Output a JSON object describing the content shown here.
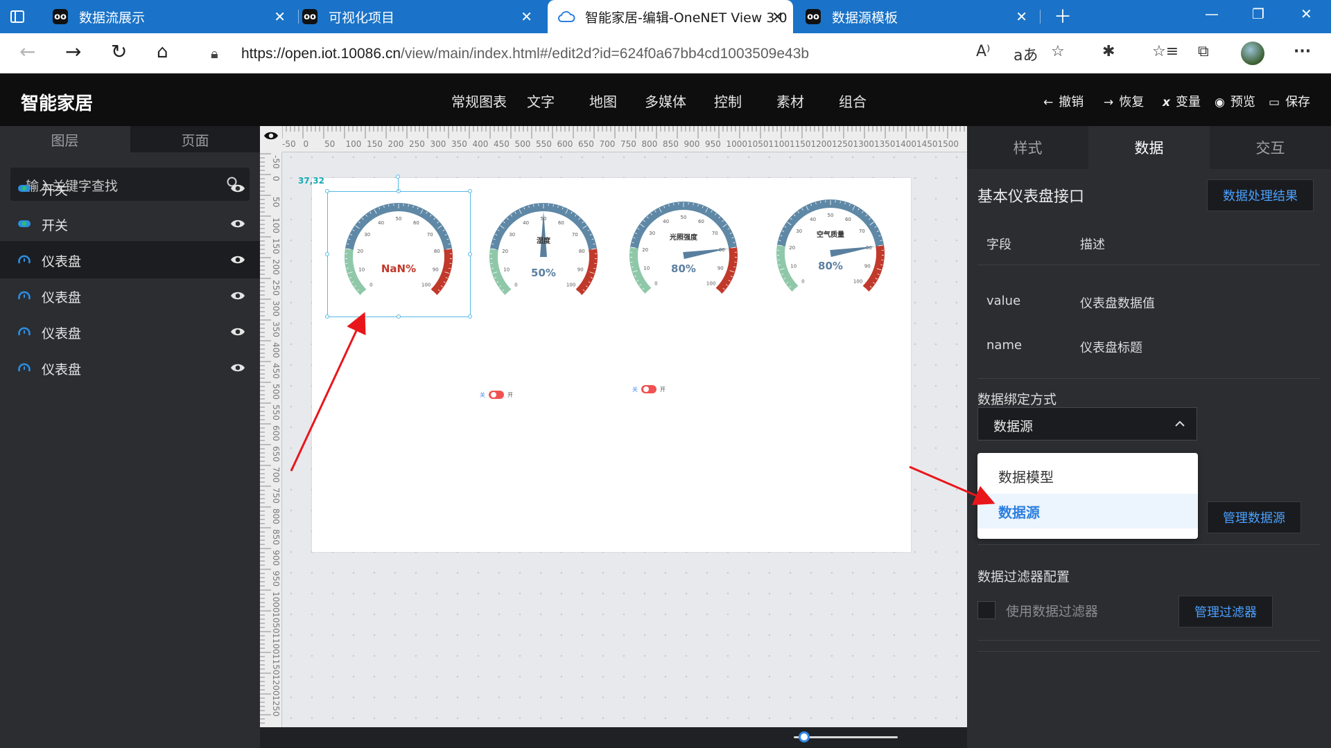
{
  "browser": {
    "tabs": [
      {
        "label": "数据流展示",
        "favicon": "oo"
      },
      {
        "label": "可视化项目",
        "favicon": "oo"
      },
      {
        "label": "智能家居-编辑-OneNET View 3.0",
        "favicon": "cloud"
      },
      {
        "label": "数据源模板",
        "favicon": "oo"
      }
    ],
    "url": "https://open.iot.10086.cn",
    "url_path": "/view/main/index.html#/edit2d?id=624f0a67bb4cd1003509e43b"
  },
  "app": {
    "title": "智能家居",
    "menu": [
      "常规图表",
      "文字",
      "地图",
      "多媒体",
      "控制",
      "素材",
      "组合"
    ],
    "actions": {
      "undo": "撤销",
      "redo": "恢复",
      "variables": "变量",
      "preview": "预览",
      "save": "保存"
    }
  },
  "left_panel": {
    "tabs": [
      "图层",
      "页面"
    ],
    "search_placeholder": "输入关键字查找",
    "layers": [
      {
        "label": "开关",
        "icon": "switch-icon"
      },
      {
        "label": "开关",
        "icon": "switch-icon"
      },
      {
        "label": "仪表盘",
        "icon": "gauge-icon",
        "selected": true
      },
      {
        "label": "仪表盘",
        "icon": "gauge-icon"
      },
      {
        "label": "仪表盘",
        "icon": "gauge-icon"
      },
      {
        "label": "仪表盘",
        "icon": "gauge-icon"
      }
    ]
  },
  "canvas": {
    "coord_badge": "37,32",
    "ruler_top": [
      "-50",
      "0",
      "50",
      "100",
      "150",
      "200",
      "250",
      "300",
      "350",
      "400",
      "450",
      "500",
      "550",
      "600",
      "650",
      "700",
      "750",
      "800",
      "850",
      "900",
      "950",
      "1000",
      "1050",
      "1100",
      "1150",
      "1200",
      "1250",
      "1300",
      "1350",
      "1400",
      "1450",
      "1500"
    ],
    "ruler_left": [
      "-50",
      "0",
      "50",
      "100",
      "150",
      "200",
      "250",
      "300",
      "350",
      "400",
      "450",
      "500",
      "550",
      "600",
      "650",
      "700",
      "750",
      "800",
      "850",
      "900",
      "950",
      "1000",
      "1050",
      "1100",
      "1150",
      "1200",
      "1250"
    ],
    "gauges": [
      {
        "title": "",
        "value_text": "NaN%",
        "value": null,
        "value_color": "#c0392b"
      },
      {
        "title": "湿度",
        "value_text": "50%",
        "value": 50,
        "value_color": "#5b7fa0"
      },
      {
        "title": "光照强度",
        "value_text": "80%",
        "value": 80,
        "value_color": "#5b7fa0"
      },
      {
        "title": "空气质量",
        "value_text": "80%",
        "value": 80,
        "value_color": "#5b7fa0"
      }
    ],
    "gauge_ticks": [
      "0",
      "10",
      "20",
      "30",
      "40",
      "50",
      "60",
      "70",
      "80",
      "90",
      "100"
    ],
    "switches": [
      {
        "off_label": "关",
        "on_label": "开"
      },
      {
        "off_label": "关",
        "on_label": "开"
      }
    ],
    "zoom_level": 0.1
  },
  "right_panel": {
    "tabs": [
      "样式",
      "数据",
      "交互"
    ],
    "title": "基本仪表盘接口",
    "result_button": "数据处理结果",
    "field_header": {
      "field": "字段",
      "desc": "描述"
    },
    "fields": [
      {
        "field": "value",
        "desc": "仪表盘数据值"
      },
      {
        "field": "name",
        "desc": "仪表盘标题"
      }
    ],
    "binding_label": "数据绑定方式",
    "binding_value": "数据源",
    "binding_options": [
      "数据模型",
      "数据源"
    ],
    "manage_source_button": "管理数据源",
    "filter_label": "数据过滤器配置",
    "use_filter_label": "使用数据过滤器",
    "manage_filter_button": "管理过滤器"
  },
  "colors": {
    "accent": "#2c7fe0",
    "tab_bar": "#1a73c8",
    "gauge_low": "#8fc8a8",
    "gauge_mid": "#5f88a6",
    "gauge_high": "#c0392b",
    "annotation": "#e8161b"
  }
}
